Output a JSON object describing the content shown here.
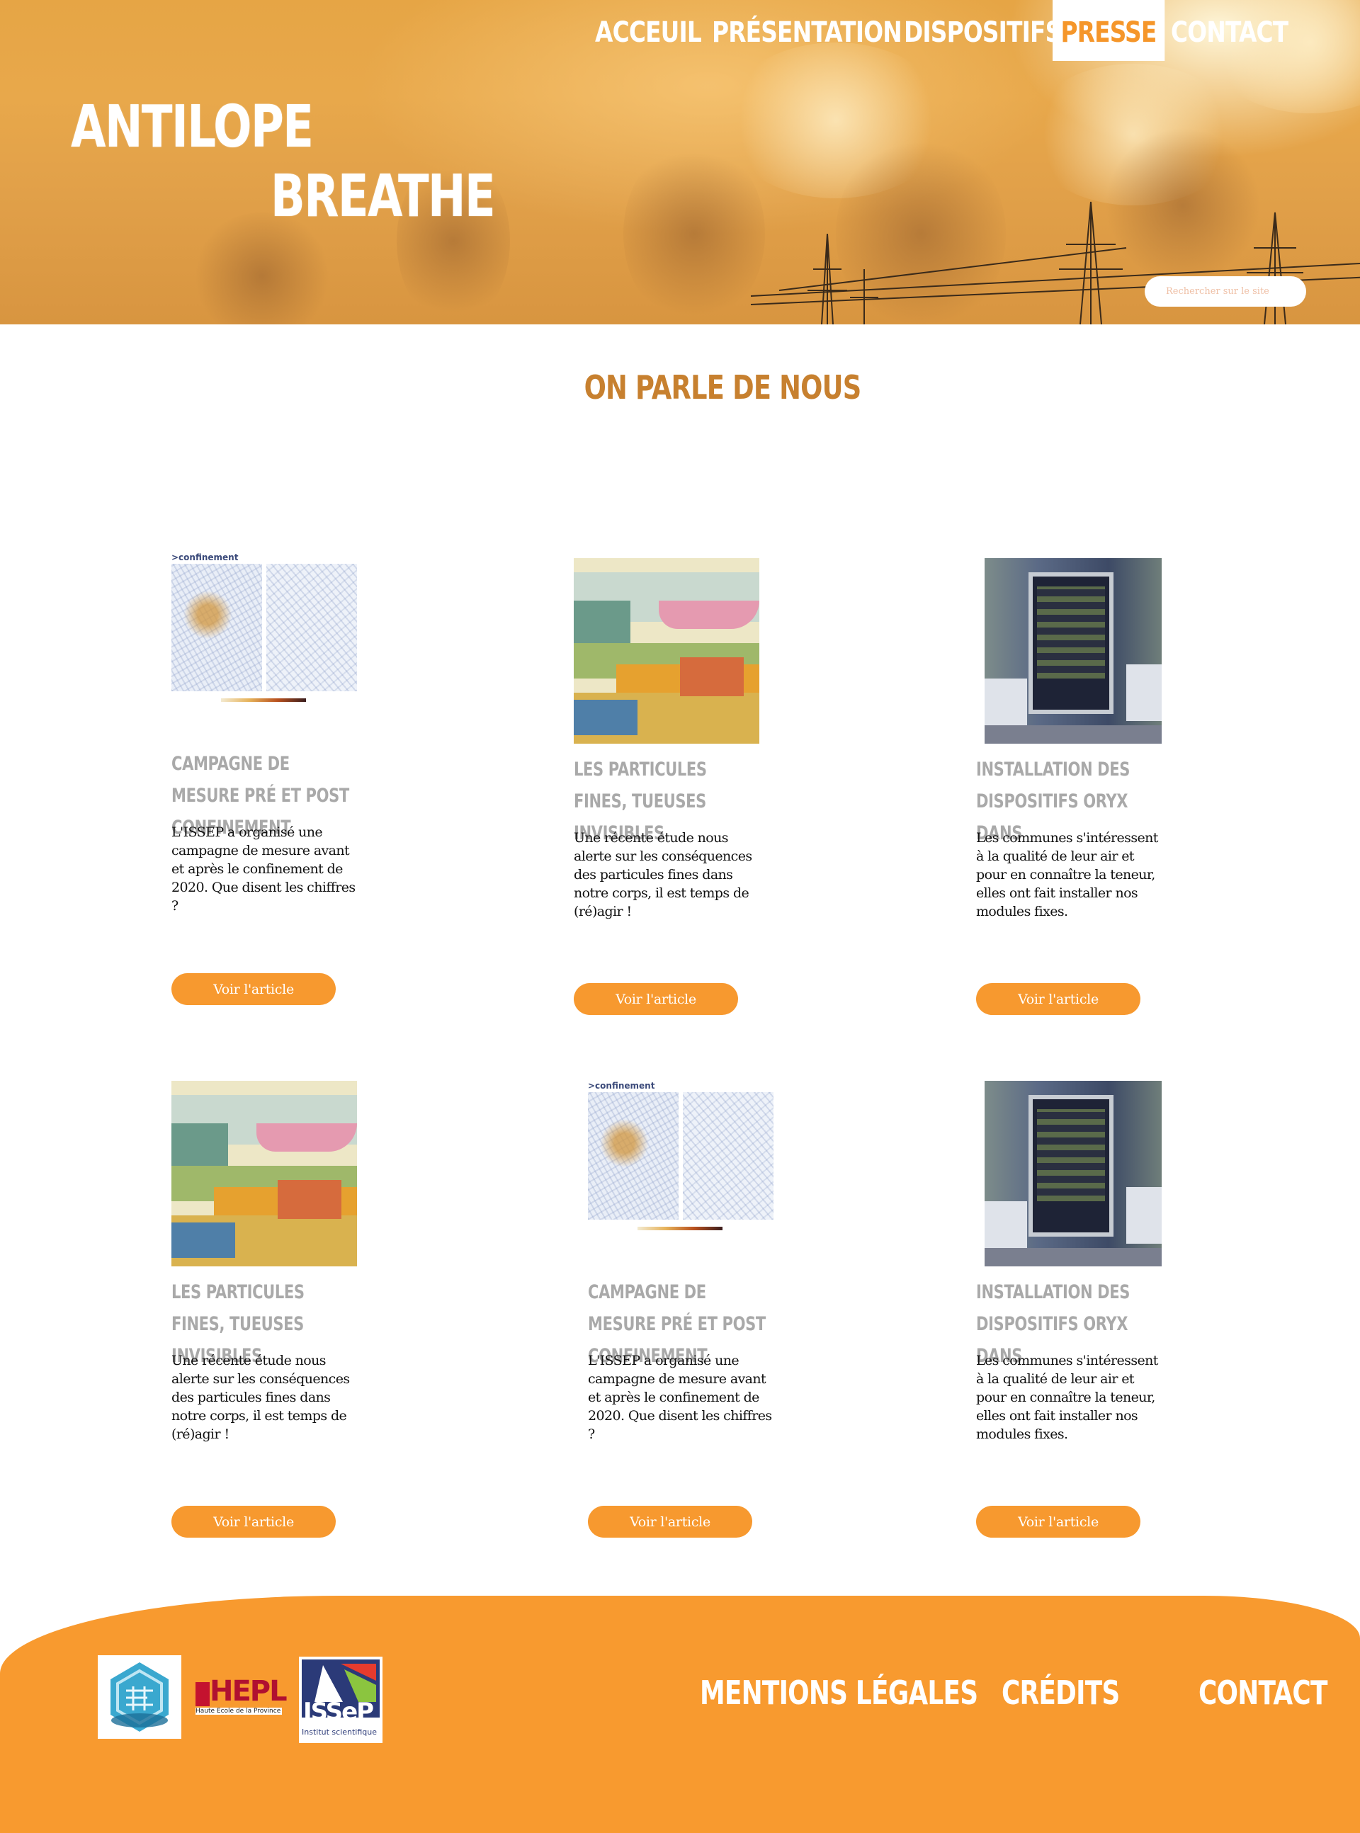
{
  "nav": {
    "items": [
      {
        "label": "ACCEUIL",
        "active": false
      },
      {
        "label": "PRÉSENTATION",
        "active": false
      },
      {
        "label": "DISPOSITIFS",
        "active": false
      },
      {
        "label": "PRESSE",
        "active": true
      },
      {
        "label": "CONTACT",
        "active": false
      }
    ]
  },
  "brand": {
    "line1": "ANTILOPE",
    "line2": "BREATHE"
  },
  "search": {
    "placeholder": "Rechercher sur le site"
  },
  "main": {
    "title": "ON PARLE DE NOUS"
  },
  "cards": [
    {
      "image": "confinement-map",
      "image_caption": ">confinement",
      "title": "CAMPAGNE DE MESURE PRÉ ET POST CONFINEMENT",
      "text": "L'ISSEP a organisé une campagne de mesure avant et après le confinement de 2020. Que disent les chiffres ?",
      "button": "Voir l'article"
    },
    {
      "image": "air-pollution-infographic",
      "title": "LES PARTICULES FINES, TUEUSES INVISIBLES",
      "text": "Une récente étude nous alerte sur les conséquences des particules fines dans notre corps, il est temps de (ré)agir !",
      "button": "Voir l'article"
    },
    {
      "image": "oryx-device-photo",
      "title": "INSTALLATION DES DISPOSITIFS ORYX DANS",
      "text": "Les communes s'intéressent à la qualité de leur air et pour en connaître la teneur, elles ont fait installer nos modules fixes.",
      "button": "Voir l'article"
    },
    {
      "image": "air-pollution-infographic",
      "title": "LES PARTICULES FINES, TUEUSES INVISIBLES",
      "text": "Une récente étude nous alerte sur les conséquences des particules fines dans notre corps, il est temps de (ré)agir !",
      "button": "Voir l'article"
    },
    {
      "image": "confinement-map",
      "image_caption": ">confinement",
      "title": "CAMPAGNE DE MESURE PRÉ ET POST CONFINEMENT",
      "text": "L'ISSEP a organisé une campagne de mesure avant et après le confinement de 2020. Que disent les chiffres ?",
      "button": "Voir l'article"
    },
    {
      "image": "oryx-device-photo",
      "title": "INSTALLATION DES DISPOSITIFS ORYX DANS",
      "text": "Les communes s'intéressent à la qualité de leur air et pour en connaître la teneur, elles ont fait installer nos modules fixes.",
      "button": "Voir l'article"
    }
  ],
  "footer": {
    "logos": [
      {
        "name": "antilope-logo"
      },
      {
        "name": "hepl-logo",
        "text": "HEPL",
        "subtext": "Haute École de la Province de Liège"
      },
      {
        "name": "issep-logo",
        "text": "ISSeP",
        "subtext": "Institut scientifique"
      }
    ],
    "links": [
      "MENTIONS LÉGALES",
      "CRÉDITS",
      "CONTACT"
    ]
  },
  "colors": {
    "accent": "#f89a2f",
    "title": "#c7802f",
    "card_title": "#a9a9a9"
  }
}
